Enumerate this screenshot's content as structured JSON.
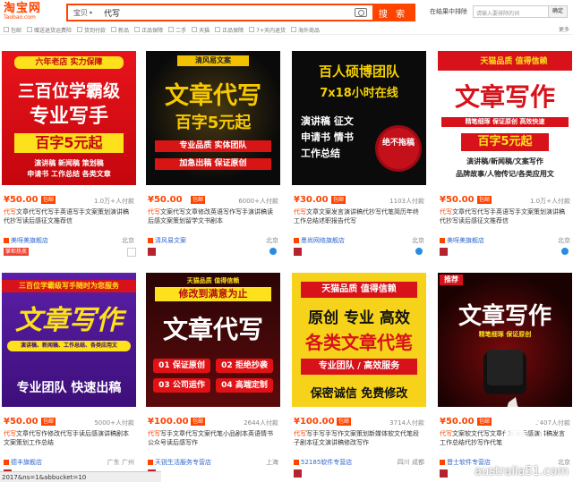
{
  "logo": {
    "cn": "淘宝网",
    "en": "Taobao.com"
  },
  "search": {
    "category": "宝贝",
    "query": "代写",
    "button": "搜 索"
  },
  "exclude": {
    "label": "在结果中排除",
    "placeholder": "请输入要排除的词",
    "button": "确定"
  },
  "filters": [
    "包邮",
    "赠送退货运费险",
    "货到付款",
    "新品",
    "正品保障",
    "二手",
    "天猫",
    "正品保障",
    "7+天内退货",
    "海外商品"
  ],
  "filters_more": "更多",
  "products": [
    {
      "price": "¥50.00",
      "tag": "包邮",
      "sold": "1.0万+人付款",
      "title_pre": "代写",
      "title_rest": "文章代写代写手英语写手文案策划演讲稿代抄写读后感征文推荐信",
      "shop": "美呀美旗舰店",
      "loc": "北京",
      "badge": "掌柜热卖",
      "poster": {
        "top": "六年老店 实力保障",
        "l1": "三百位学霸级",
        "l2": "专业写手",
        "l3": "百字5元起",
        "l4": "演讲稿 新闻稿 策划稿",
        "l5": "申请书 工作总结 各类文章"
      }
    },
    {
      "price": "¥50.00",
      "tag": "包邮",
      "sold": "6000+人付款",
      "title_pre": "代写",
      "title_rest": "文案代写文章修改英语写作写手演讲稿读后感文案策划留学文书剧本",
      "shop": "清风易文案",
      "loc": "北京",
      "badge": "",
      "poster": {
        "top": "清风易文案",
        "l1": "文章代写",
        "l2": "百字5元起",
        "l3": "专业品质 实体团队",
        "l4": "加急出稿 保证原创"
      }
    },
    {
      "price": "¥30.00",
      "tag": "包邮",
      "sold": "1103人付款",
      "title_pre": "代写",
      "title_rest": "文章文案发言演讲稿代抄写代笔简历年终工作总结述职报告代写",
      "shop": "墨尚网络旗舰店",
      "loc": "北京",
      "badge": "",
      "poster": {
        "l1": "百人硕博团队",
        "l2": "7x18小时在线",
        "l3": "演讲稿 征文",
        "l4": "申请书 情书",
        "l5": "工作总结",
        "seal": "绝不拖稿"
      }
    },
    {
      "price": "¥50.00",
      "tag": "包邮",
      "sold": "1.0万+人付款",
      "title_pre": "代写",
      "title_rest": "文章代写代写手英语写手文案策划演讲稿代抄写读后感征文推荐信",
      "shop": "美呀美旗舰店",
      "loc": "北京",
      "badge": "",
      "poster": {
        "top": "天猫品质 值得信赖",
        "l1": "文章写作",
        "l2": "精笔细琢 保证原创 高效快速",
        "l3": "百字5元起",
        "l4": "演讲稿/新闻稿/文案写作",
        "l5": "品牌故事/人物传记/各类应用文"
      }
    },
    {
      "price": "¥50.00",
      "tag": "包邮",
      "sold": "5000+人付款",
      "title_pre": "代写",
      "title_rest": "文章代写作修改代写手读后感演讲稿剧本文案策划工作总结",
      "shop": "德丰旗舰店",
      "loc": "广东 广州",
      "badge": "",
      "poster": {
        "top": "三百位学霸级写手随时为您服务",
        "l1": "文章写作",
        "l2": "演讲稿、新闻稿、工作总结、各类应用文",
        "l3": "专业团队 快速出稿"
      }
    },
    {
      "price": "¥100.00",
      "tag": "包邮",
      "sold": "2644人付款",
      "title_pre": "代写",
      "title_rest": "写手文章代写文案代笔小品剧本英语情书公众号读后感写作",
      "shop": "天锐生活服务专营店",
      "loc": "上海",
      "badge": "",
      "poster": {
        "top": "天猫品质 值得信赖",
        "l0": "修改到满意为止",
        "l1": "文章代写",
        "b1": "01 保证原创",
        "b2": "02 拒绝抄袭",
        "b3": "03 公司运作",
        "b4": "04 高端定制"
      }
    },
    {
      "price": "¥100.00",
      "tag": "包邮",
      "sold": "3714人付款",
      "title_pre": "代写",
      "title_rest": "写手写手写作文案策划新媒体软文代笔段子剧本征文演讲稿修改写作",
      "shop": "52185软件专营店",
      "loc": "四川 成都",
      "badge": "",
      "poster": {
        "top": "天猫品质 值得信赖",
        "l1": "原创 专业 高效",
        "l2": "各类文章代笔",
        "l3": "专业团队 / 高效服务",
        "l4": "保密诚信 免费修改"
      }
    },
    {
      "price": "¥50.00",
      "tag": "包邮",
      "sold": "3407人付款",
      "title_pre": "代写",
      "title_rest": "文案软文代写文章代写读后感演讲稿发言工作总结代抄写作代笔",
      "shop": "晋士软件专营店",
      "loc": "北京",
      "badge": "",
      "poster": {
        "tag": "推荐",
        "l1": "文章写作",
        "l2": "精笔细琢 保证原创"
      }
    }
  ],
  "statusbar": "2017&ns=1&abbucket=10",
  "watermark": "australia51.com"
}
